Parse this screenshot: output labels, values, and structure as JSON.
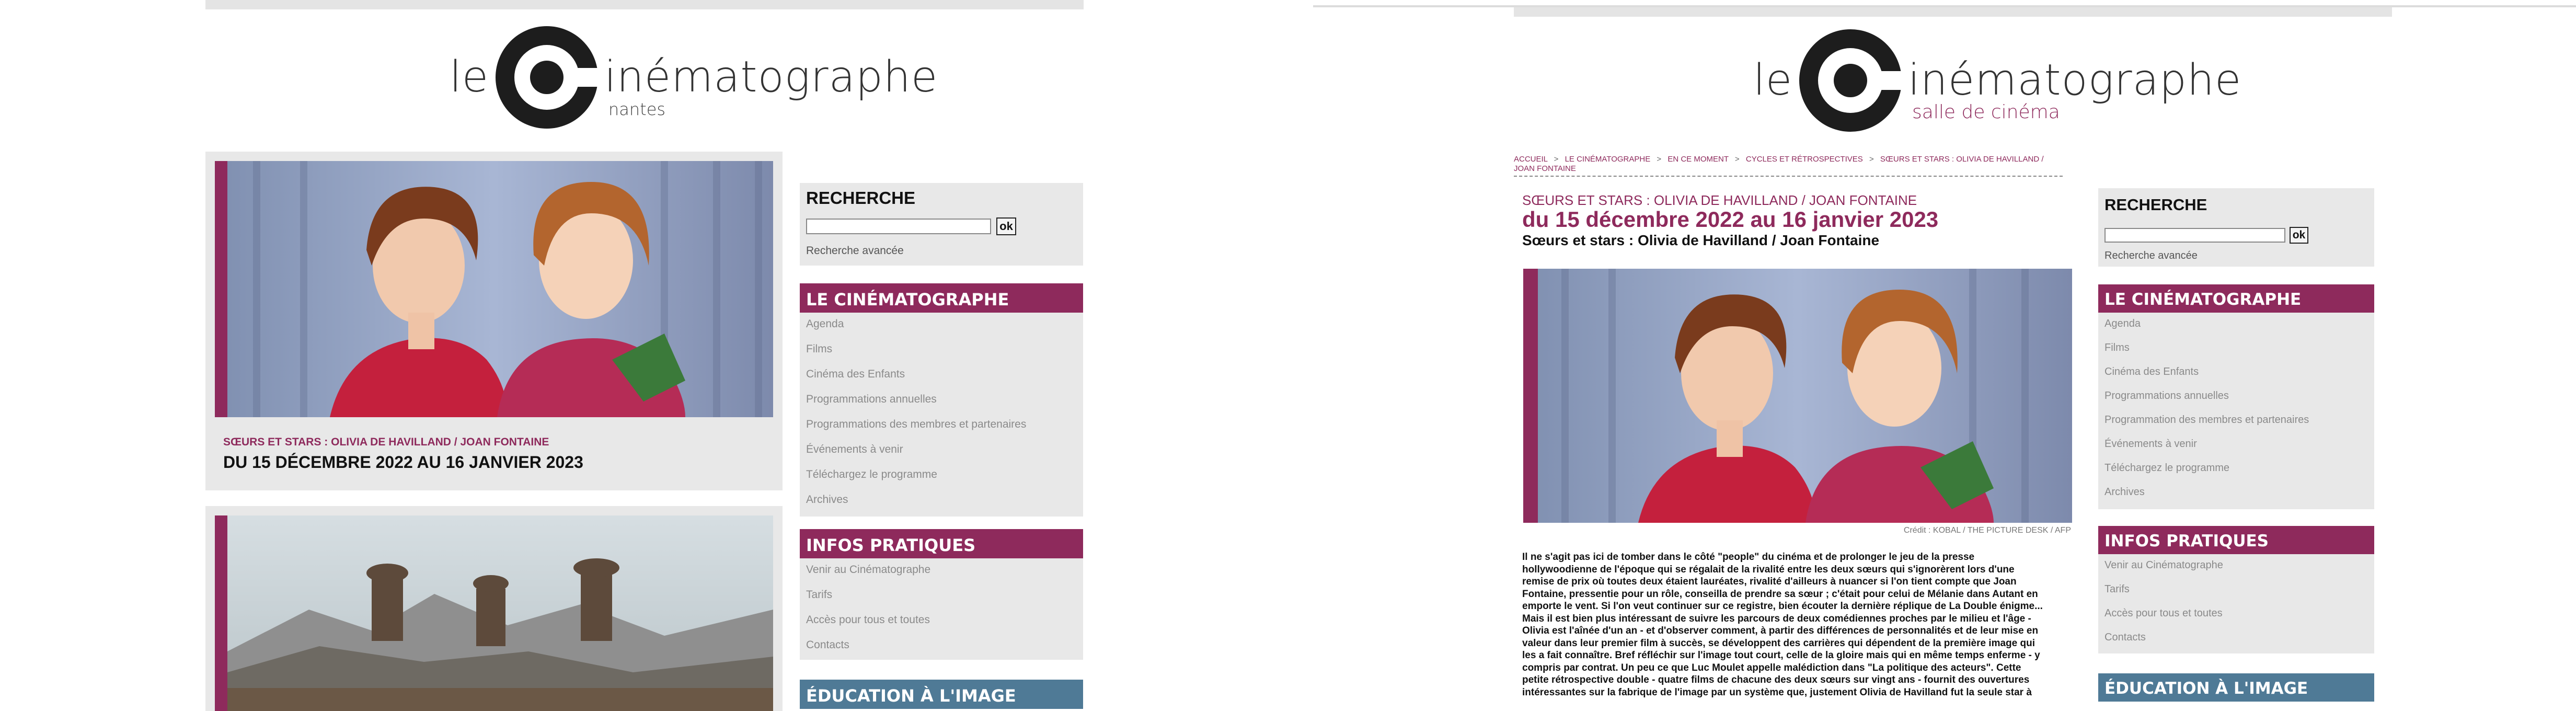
{
  "colors": {
    "brand_maroon": "#8e2a5c",
    "teal": "#4f7a96",
    "panel_gray": "#e8e8e8",
    "link_gray": "#8a8a8a"
  },
  "left": {
    "logo": {
      "le": "le",
      "word": "inématographe",
      "sub": "nantes"
    },
    "feature": {
      "kicker": "SŒURS ET STARS : OLIVIA DE HAVILLAND / JOAN FONTAINE",
      "dates": "DU 15 DÉCEMBRE 2022 AU 16 JANVIER 2023"
    },
    "sidebar": {
      "search": {
        "label": "RECHERCHE",
        "ok": "ok",
        "advanced": "Recherche avancée",
        "value": ""
      },
      "cinematographe": {
        "title": "LE CINÉMATOGRAPHE",
        "items": [
          "Agenda",
          "Films",
          "Cinéma des Enfants",
          "Programmations annuelles",
          "Programmations des membres et partenaires",
          "Événements à venir",
          "Téléchargez le programme",
          "Archives"
        ]
      },
      "infos": {
        "title": "INFOS PRATIQUES",
        "items": [
          "Venir au Cinématographe",
          "Tarifs",
          "Accès pour tous et toutes",
          "Contacts"
        ]
      },
      "education": {
        "title": "ÉDUCATION À L'IMAGE"
      }
    }
  },
  "right": {
    "logo": {
      "le": "le",
      "word": "inématographe",
      "sub": "salle de cinéma"
    },
    "breadcrumb": [
      "ACCUEIL",
      "LE CINÉMATOGRAPHE",
      "EN CE MOMENT",
      "CYCLES ET RÉTROSPECTIVES",
      "SŒURS ET STARS : OLIVIA DE HAVILLAND / JOAN FONTAINE"
    ],
    "breadcrumb_sep": ">",
    "article": {
      "kicker": "SŒURS ET STARS : OLIVIA DE HAVILLAND / JOAN FONTAINE",
      "dates": "du 15 décembre 2022 au 16 janvier 2023",
      "subtitle": "Sœurs et stars : Olivia de Havilland / Joan Fontaine",
      "credit": "Crédit : KOBAL / THE PICTURE DESK / AFP",
      "body_lines": [
        "Il ne s'agit pas ici de tomber dans le côté \"people\" du cinéma et de prolonger le jeu de la presse",
        "hollywoodienne de l'époque qui se régalait de la rivalité entre les deux sœurs qui s'ignorèrent lors d'une",
        "remise de prix où toutes deux étaient lauréates, rivalité d'ailleurs à nuancer si l'on tient compte que Joan",
        "Fontaine, pressentie pour un rôle, conseilla de prendre sa sœur ; c'était pour celui de Mélanie dans Autant en",
        "emporte le vent. Si l'on veut continuer sur ce registre, bien écouter la dernière réplique de La Double énigme...",
        "Mais il est bien plus intéressant de suivre les parcours de deux comédiennes proches par le milieu et l'âge -",
        "Olivia est l'aînée d'un an - et d'observer comment, à partir des différences de personnalités et de leur mise en",
        "valeur dans leur premier film à succès, se développent des carrières qui dépendent de la première image qui",
        "les a fait connaître. Bref réfléchir sur l'image tout court, celle de la gloire mais qui en même temps enferme - y",
        "compris par contrat. Un peu ce que Luc Moulet appelle malédiction dans \"La politique des acteurs\". Cette",
        "petite rétrospective double - quatre films de chacune des deux sœurs sur vingt ans - fournit des ouvertures",
        "intéressantes sur la fabrique de l'image par un système que, justement Olivia de Havilland fut la seule star à"
      ]
    },
    "sidebar": {
      "search": {
        "label": "RECHERCHE",
        "ok": "ok",
        "advanced": "Recherche avancée",
        "value": ""
      },
      "cinematographe": {
        "title": "LE CINÉMATOGRAPHE",
        "items": [
          "Agenda",
          "Films",
          "Cinéma des Enfants",
          "Programmations annuelles",
          "Programmation des membres et partenaires",
          "Événements à venir",
          "Téléchargez le programme",
          "Archives"
        ]
      },
      "infos": {
        "title": "INFOS PRATIQUES",
        "items": [
          "Venir au Cinématographe",
          "Tarifs",
          "Accès pour tous et toutes",
          "Contacts"
        ]
      },
      "education": {
        "title": "ÉDUCATION À L'IMAGE"
      }
    }
  }
}
